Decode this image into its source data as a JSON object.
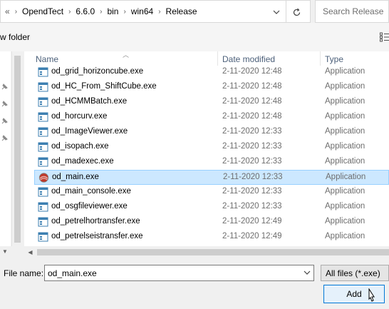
{
  "address": {
    "overflow": "«",
    "segments": [
      "OpendTect",
      "6.6.0",
      "bin",
      "win64",
      "Release"
    ]
  },
  "search": {
    "placeholder": "Search Release"
  },
  "toolbar": {
    "new_folder": "w folder"
  },
  "columns": {
    "name": "Name",
    "date": "Date modified",
    "type": "Type"
  },
  "files": [
    {
      "name": "od_grid_horizoncube.exe",
      "date": "2-11-2020 12:48",
      "type": "Application",
      "icon": "exe-window-icon"
    },
    {
      "name": "od_HC_From_ShiftCube.exe",
      "date": "2-11-2020 12:48",
      "type": "Application",
      "icon": "exe-window-icon"
    },
    {
      "name": "od_HCMMBatch.exe",
      "date": "2-11-2020 12:48",
      "type": "Application",
      "icon": "exe-window-icon"
    },
    {
      "name": "od_horcurv.exe",
      "date": "2-11-2020 12:48",
      "type": "Application",
      "icon": "exe-window-icon"
    },
    {
      "name": "od_ImageViewer.exe",
      "date": "2-11-2020 12:33",
      "type": "Application",
      "icon": "exe-window-icon"
    },
    {
      "name": "od_isopach.exe",
      "date": "2-11-2020 12:33",
      "type": "Application",
      "icon": "exe-window-icon"
    },
    {
      "name": "od_madexec.exe",
      "date": "2-11-2020 12:33",
      "type": "Application",
      "icon": "exe-window-icon"
    },
    {
      "name": "od_main.exe",
      "date": "2-11-2020 12:33",
      "type": "Application",
      "icon": "opendtect-logo-icon",
      "selected": true
    },
    {
      "name": "od_main_console.exe",
      "date": "2-11-2020 12:33",
      "type": "Application",
      "icon": "exe-window-icon"
    },
    {
      "name": "od_osgfileviewer.exe",
      "date": "2-11-2020 12:33",
      "type": "Application",
      "icon": "exe-window-icon"
    },
    {
      "name": "od_petrelhortransfer.exe",
      "date": "2-11-2020 12:49",
      "type": "Application",
      "icon": "exe-window-icon"
    },
    {
      "name": "od_petrelseistransfer.exe",
      "date": "2-11-2020 12:49",
      "type": "Application",
      "icon": "exe-window-icon"
    }
  ],
  "footer": {
    "file_name_label": "File name:",
    "file_name_value": "od_main.exe",
    "filter": "All files (*.exe)",
    "add_label": "Add"
  },
  "colors": {
    "selection_bg": "#cce8ff",
    "selection_border": "#99d1ff",
    "accent": "#0078d7"
  }
}
